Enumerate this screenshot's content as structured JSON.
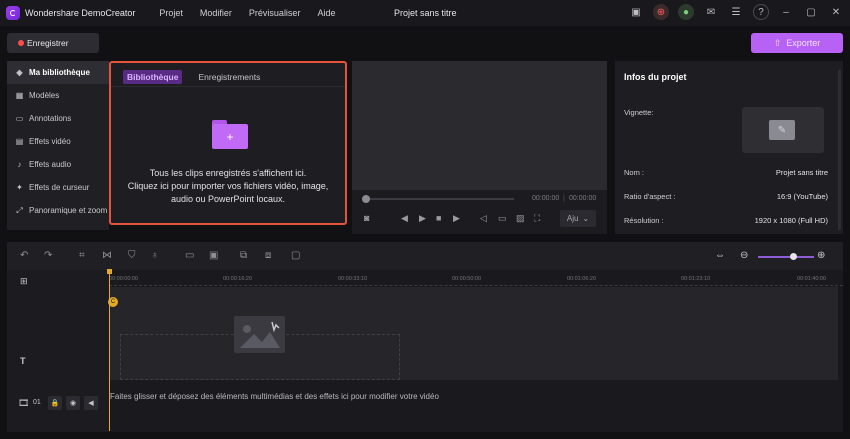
{
  "app": {
    "name": "Wondershare DemoCreator",
    "window_title": "Projet sans titre",
    "accent": "#b862f5",
    "menu": [
      {
        "label": "Projet"
      },
      {
        "label": "Modifier"
      },
      {
        "label": "Prévisualiser"
      },
      {
        "label": "Aide"
      }
    ]
  },
  "toolbar": {
    "record_label": "Enregistrer",
    "export_label": "Exporter"
  },
  "sidebar": {
    "items": [
      {
        "label": "Ma bibliothèque",
        "icon": "layers-icon"
      },
      {
        "label": "Modèles",
        "icon": "template-icon"
      },
      {
        "label": "Annotations",
        "icon": "comment-icon"
      },
      {
        "label": "Effets vidéo",
        "icon": "video-fx-icon"
      },
      {
        "label": "Effets audio",
        "icon": "music-note-icon"
      },
      {
        "label": "Effets de curseur",
        "icon": "cursor-icon"
      },
      {
        "label": "Panoramique et zoom",
        "icon": "pan-zoom-icon"
      }
    ]
  },
  "library": {
    "tabs": [
      {
        "label": "Bibliothèque"
      },
      {
        "label": "Enregistrements"
      }
    ],
    "message_line1": "Tous les clips enregistrés s'affichent ici.",
    "message_line2": "Cliquez ici pour importer vos fichiers vidéo, image,",
    "message_line3": "audio ou PowerPoint locaux."
  },
  "preview": {
    "current_time": "00:00:00",
    "total_time": "00:00:00",
    "fit_label": "Aju"
  },
  "project_info": {
    "title": "Infos du projet",
    "thumbnail_label": "Vignette:",
    "name_label": "Nom :",
    "name_value": "Projet sans titre",
    "ratio_label": "Ratio d'aspect :",
    "ratio_value": "16:9 (YouTube)",
    "resolution_label": "Résolution :",
    "resolution_value": "1920 x 1080 (Full HD)"
  },
  "timeline": {
    "ticks": [
      "00:00:00:00",
      "00:00:16:20",
      "00:00:33:10",
      "00:00:50:00",
      "00:01:06:20",
      "00:01:23:10",
      "00:01:40:00"
    ],
    "track_number": "01",
    "drop_message": "Faites glisser et déposez des éléments multimédias et des effets ici pour modifier votre vidéo"
  }
}
